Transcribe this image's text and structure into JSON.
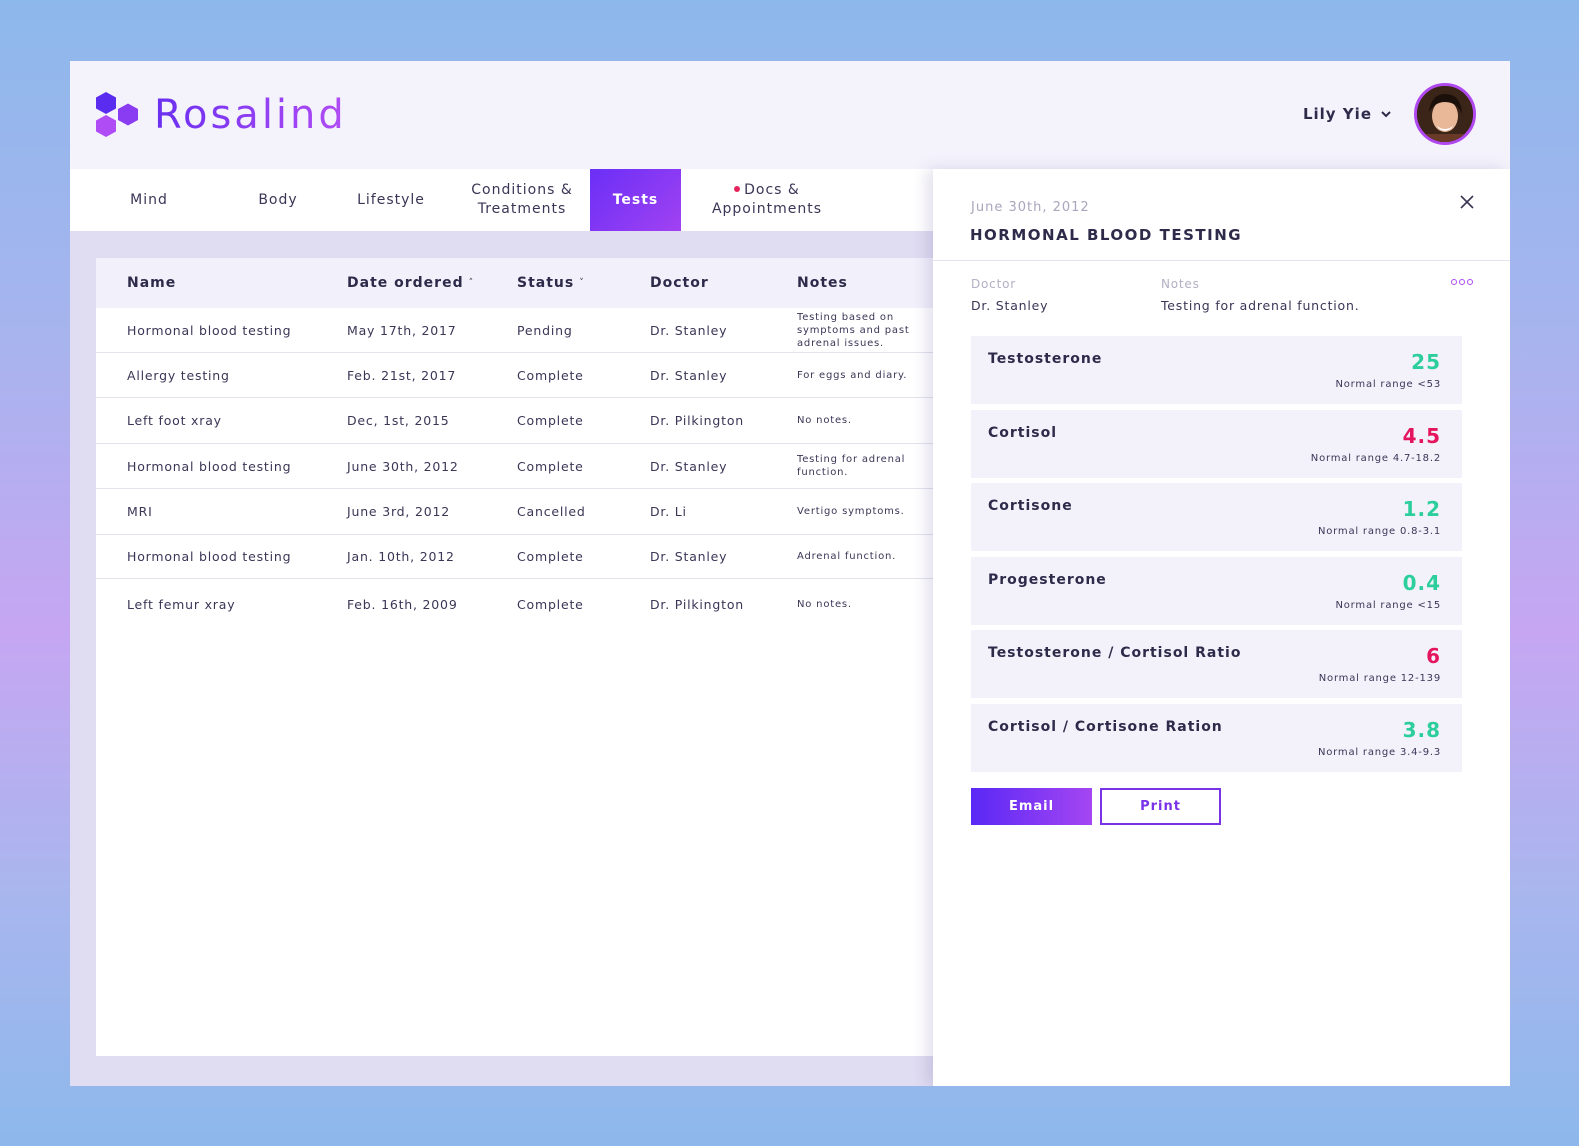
{
  "app": {
    "brand": "Rosalind",
    "user_name": "Lily Yie"
  },
  "tabs": [
    {
      "label": "Mind"
    },
    {
      "label": "Body"
    },
    {
      "label": "Lifestyle"
    },
    {
      "label": "Conditions & Treatments"
    },
    {
      "label": "Tests"
    },
    {
      "label": "Docs & Appointments"
    }
  ],
  "table": {
    "headers": {
      "name": "Name",
      "date": "Date ordered",
      "status": "Status",
      "doctor": "Doctor",
      "notes": "Notes"
    },
    "rows": [
      {
        "name": "Hormonal blood testing",
        "date": "May 17th, 2017",
        "status": "Pending",
        "doctor": "Dr. Stanley",
        "notes": "Testing based on symptoms and past adrenal issues."
      },
      {
        "name": "Allergy testing",
        "date": "Feb. 21st, 2017",
        "status": "Complete",
        "doctor": "Dr. Stanley",
        "notes": "For eggs and diary."
      },
      {
        "name": "Left foot xray",
        "date": "Dec, 1st, 2015",
        "status": "Complete",
        "doctor": "Dr. Pilkington",
        "notes": "No notes."
      },
      {
        "name": "Hormonal blood testing",
        "date": "June 30th, 2012",
        "status": "Complete",
        "doctor": "Dr. Stanley",
        "notes": "Testing for adrenal function."
      },
      {
        "name": "MRI",
        "date": "June 3rd, 2012",
        "status": "Cancelled",
        "doctor": "Dr. Li",
        "notes": "Vertigo symptoms."
      },
      {
        "name": "Hormonal blood testing",
        "date": "Jan. 10th, 2012",
        "status": "Complete",
        "doctor": "Dr. Stanley",
        "notes": "Adrenal function."
      },
      {
        "name": "Left femur xray",
        "date": "Feb. 16th, 2009",
        "status": "Complete",
        "doctor": "Dr. Pilkington",
        "notes": "No notes."
      }
    ]
  },
  "panel": {
    "date": "June 30th, 2012",
    "title": "HORMONAL BLOOD TESTING",
    "doctor_label": "Doctor",
    "doctor_value": "Dr. Stanley",
    "notes_label": "Notes",
    "notes_value": "Testing for adrenal function.",
    "results": [
      {
        "name": "Testosterone",
        "value": "25",
        "range": "Normal range <53",
        "in_range": true
      },
      {
        "name": "Cortisol",
        "value": "4.5",
        "range": "Normal range 4.7-18.2",
        "in_range": false
      },
      {
        "name": "Cortisone",
        "value": "1.2",
        "range": "Normal range 0.8-3.1",
        "in_range": true
      },
      {
        "name": "Progesterone",
        "value": "0.4",
        "range": "Normal range <15",
        "in_range": true
      },
      {
        "name": "Testosterone / Cortisol Ratio",
        "value": "6",
        "range": "Normal range 12-139",
        "in_range": false
      },
      {
        "name": "Cortisol / Cortisone Ration",
        "value": "3.8",
        "range": "Normal range 3.4-9.3",
        "in_range": true
      }
    ],
    "email_label": "Email",
    "print_label": "Print"
  },
  "colors": {
    "accent": "#6a2ff6",
    "accent_end": "#a142f2",
    "in_range": "#2ccf9b",
    "out_of_range": "#e5155d",
    "alert_dot": "#e5245e"
  }
}
